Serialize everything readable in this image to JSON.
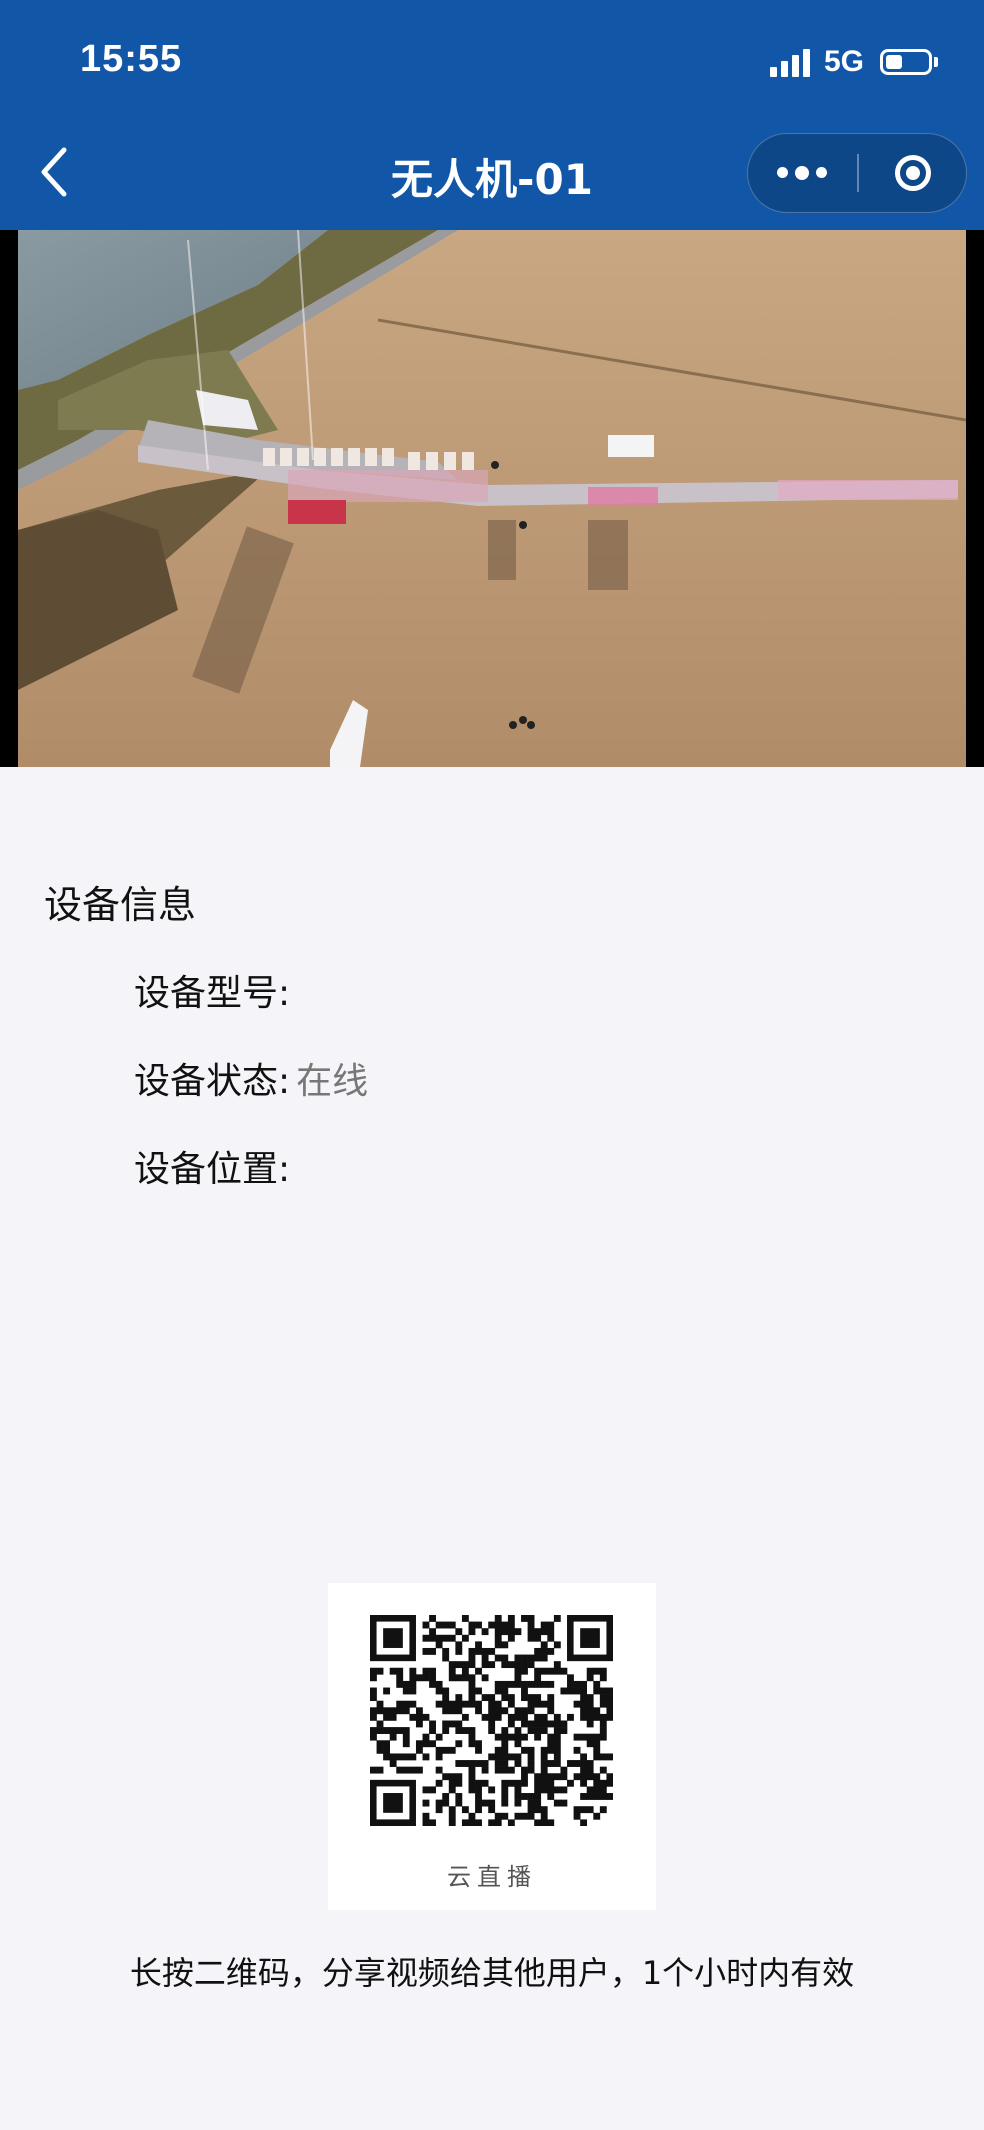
{
  "status_bar": {
    "time": "15:55",
    "network": "5G",
    "battery_level": 0.4
  },
  "nav": {
    "title": "无人机-01"
  },
  "colors": {
    "nav_bg": "#1257a7",
    "page_bg": "#f5f4f9"
  },
  "icons": [
    "back-chevron-icon",
    "more-dots-icon",
    "close-target-icon"
  ],
  "device_info": {
    "section_title": "设备信息",
    "model_label": "设备型号:",
    "model_value": "",
    "status_label": "设备状态:",
    "status_value": "在线",
    "location_label": "设备位置:",
    "location_value": ""
  },
  "share": {
    "qr_caption": "云直播",
    "hint": "长按二维码，分享视频给其他用户，1个小时内有效"
  }
}
